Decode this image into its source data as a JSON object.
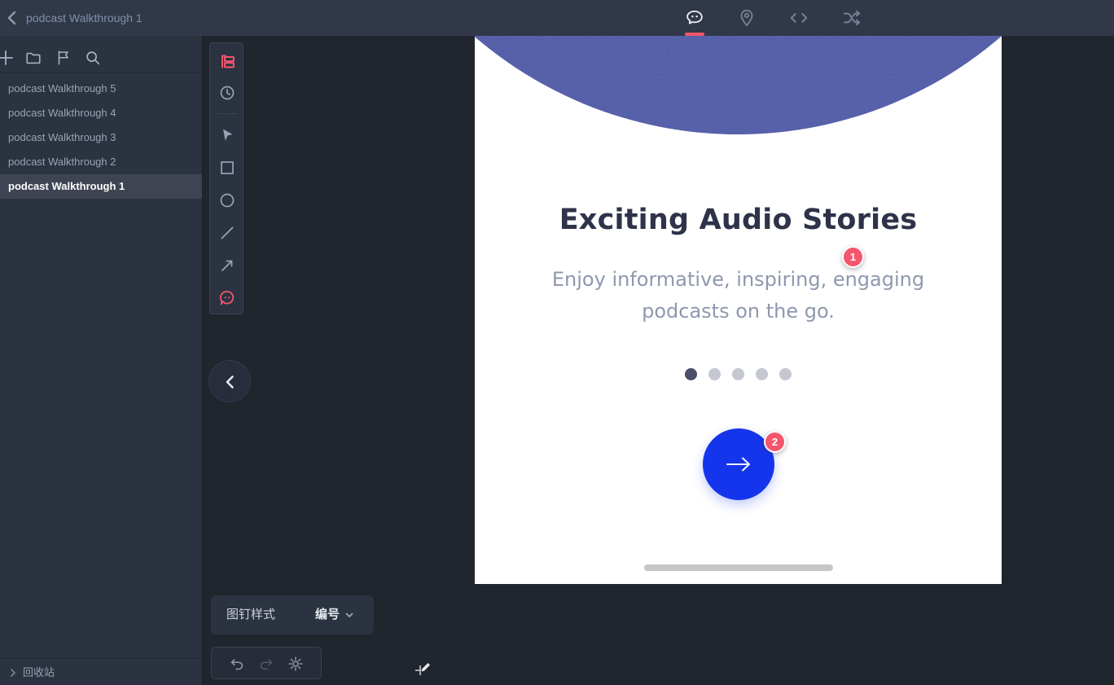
{
  "topbar": {
    "title": "podcast Walkthrough 1",
    "tabs": [
      {
        "name": "comments",
        "active": true
      },
      {
        "name": "pins",
        "active": false
      },
      {
        "name": "embed-code",
        "active": false
      },
      {
        "name": "flow",
        "active": false
      }
    ]
  },
  "sidebar": {
    "toolbar_icons": [
      "add",
      "folder",
      "flag",
      "search"
    ],
    "items": [
      {
        "label": "podcast Walkthrough 5",
        "selected": false
      },
      {
        "label": "podcast Walkthrough 4",
        "selected": false
      },
      {
        "label": "podcast Walkthrough 3",
        "selected": false
      },
      {
        "label": "podcast Walkthrough 2",
        "selected": false
      },
      {
        "label": "podcast Walkthrough 1",
        "selected": true
      }
    ],
    "recycle_bin_label": "回收站"
  },
  "tool_palette": {
    "tools": [
      "pin-list",
      "history",
      "pointer",
      "rectangle",
      "ellipse",
      "line",
      "arrow",
      "comment-pin"
    ],
    "active_tool": "comment-pin"
  },
  "pin_panel": {
    "style_label": "图钉样式",
    "style_value": "编号"
  },
  "history_bar": {
    "buttons": [
      "undo",
      "redo",
      "settings"
    ]
  },
  "canvas": {
    "heading": "Exciting Audio Stories",
    "subtitle_line1": "Enjoy informative, inspiring, engaging",
    "subtitle_line2": "podcasts on the go.",
    "pagination": {
      "count": 5,
      "active_index": 0
    },
    "pins": [
      {
        "number": "1"
      },
      {
        "number": "2"
      }
    ]
  },
  "colors": {
    "accent_pink": "#f4566d",
    "button_blue": "#1535ec",
    "hero_circle_blue": "#4753a7",
    "heading_text": "#2e3349",
    "subtitle_text": "#8e98ae",
    "topbar_bg": "#313848",
    "sidebar_bg": "#2b3240",
    "workspace_bg": "#20252e"
  }
}
